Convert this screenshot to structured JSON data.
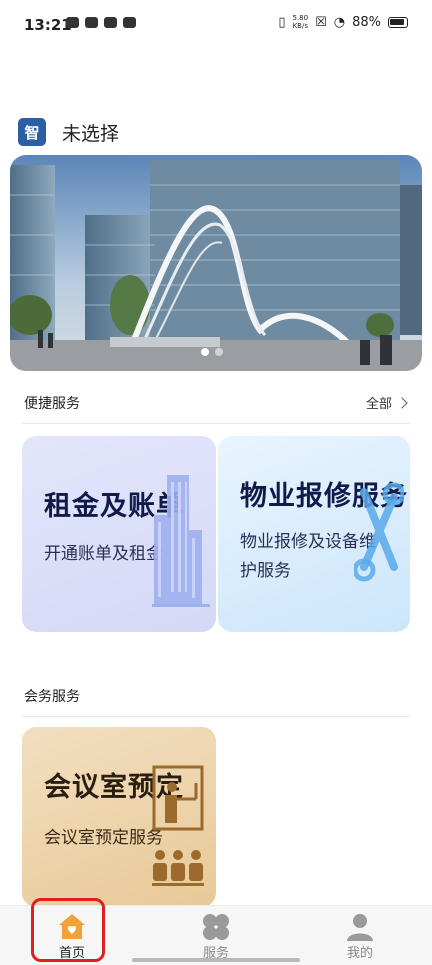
{
  "status_bar": {
    "time": "13:21",
    "net_speed": "5.80\nKB/s",
    "battery": "88%"
  },
  "header": {
    "building_name": "未选择"
  },
  "banner": {
    "slide_count": 2,
    "active_index": 0
  },
  "quick_services": {
    "title": "便捷服务",
    "more_label": "全部",
    "cards": [
      {
        "title": "租金及账单",
        "subtitle": "开通账单及租金"
      },
      {
        "title": "物业报修服务",
        "subtitle_line1": "物业报修及设备维",
        "subtitle_line2": "护服务"
      }
    ]
  },
  "meeting_services": {
    "title": "会务服务",
    "cards": [
      {
        "title": "会议室预定",
        "subtitle": "会议室预定服务"
      }
    ]
  },
  "tabbar": {
    "home": "首页",
    "services": "服务",
    "mine": "我的",
    "active_color": "#f2a23a",
    "inactive_color": "#9a9a9a"
  }
}
